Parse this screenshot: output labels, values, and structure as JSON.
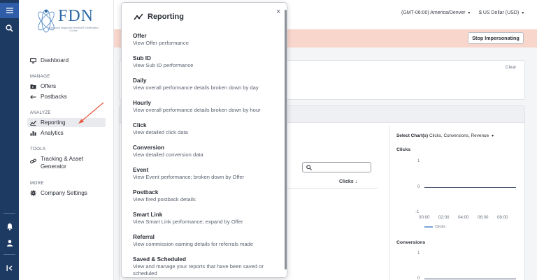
{
  "header": {
    "timezone": "(GMT-06:00) America/Denver",
    "currency": "$ US Dollar (USD)"
  },
  "logo": {
    "text": "FDN",
    "subtitle": "Functional Diagnostic Nutrition® Certification Course"
  },
  "sidebar": {
    "dashboard": "Dashboard",
    "sections": {
      "manage": "MANAGE",
      "analyze": "ANALYZE",
      "tools": "TOOLS",
      "more": "MORE"
    },
    "items": {
      "offers": "Offers",
      "postbacks": "Postbacks",
      "reporting": "Reporting",
      "analytics": "Analytics",
      "tracking_line1": "Tracking & Asset",
      "tracking_line2": "Generator",
      "company_settings": "Company Settings"
    }
  },
  "banner": {
    "stop_label": "Stop Impersonating"
  },
  "filters": {
    "clear_label": "Clear"
  },
  "table": {
    "search_placeholder": "",
    "clicks_header": "Clicks ↓"
  },
  "charts": {
    "select_label": "Select Chart(s)",
    "select_value": "Clicks, Conversions, Revenue"
  },
  "chart_data": [
    {
      "type": "line",
      "title": "Clicks",
      "x": [
        "00:00",
        "02:00",
        "04:00",
        "06:00",
        "08:00"
      ],
      "series": [
        {
          "name": "Clicks",
          "values": [
            0,
            0,
            0,
            0,
            0
          ]
        }
      ],
      "ylim": [
        -1,
        1
      ],
      "yticks": [
        "1",
        "0",
        "-1"
      ],
      "legend": "bottom-left"
    },
    {
      "type": "line",
      "title": "Conversions",
      "yticks": [
        "1",
        "0"
      ],
      "ylim": [
        0,
        1
      ]
    }
  ],
  "popover": {
    "title": "Reporting",
    "close": "×",
    "items": [
      {
        "title": "Offer",
        "desc": "View Offer performance"
      },
      {
        "title": "Sub ID",
        "desc": "View Sub ID performance"
      },
      {
        "title": "Daily",
        "desc": "View overall performance details broken down by day"
      },
      {
        "title": "Hourly",
        "desc": "View overall performance details broken down by hour"
      },
      {
        "title": "Click",
        "desc": "View detailed click data"
      },
      {
        "title": "Conversion",
        "desc": "View detailed conversion data"
      },
      {
        "title": "Event",
        "desc": "View Event performance; broken down by Offer"
      },
      {
        "title": "Postback",
        "desc": "View fired postback details"
      },
      {
        "title": "Smart Link",
        "desc": "View Smart Link performance; expand by Offer"
      },
      {
        "title": "Referral",
        "desc": "View commission earning details for referrals made"
      },
      {
        "title": "Saved & Scheduled",
        "desc": "View and manage your reports that have been saved or scheduled"
      }
    ]
  },
  "colors": {
    "rail": "#1d3a63",
    "rail_active": "#2f5da8",
    "banner": "#f9d6cc",
    "brand": "#2e6aa5",
    "annotation_arrow": "#e8553e"
  }
}
